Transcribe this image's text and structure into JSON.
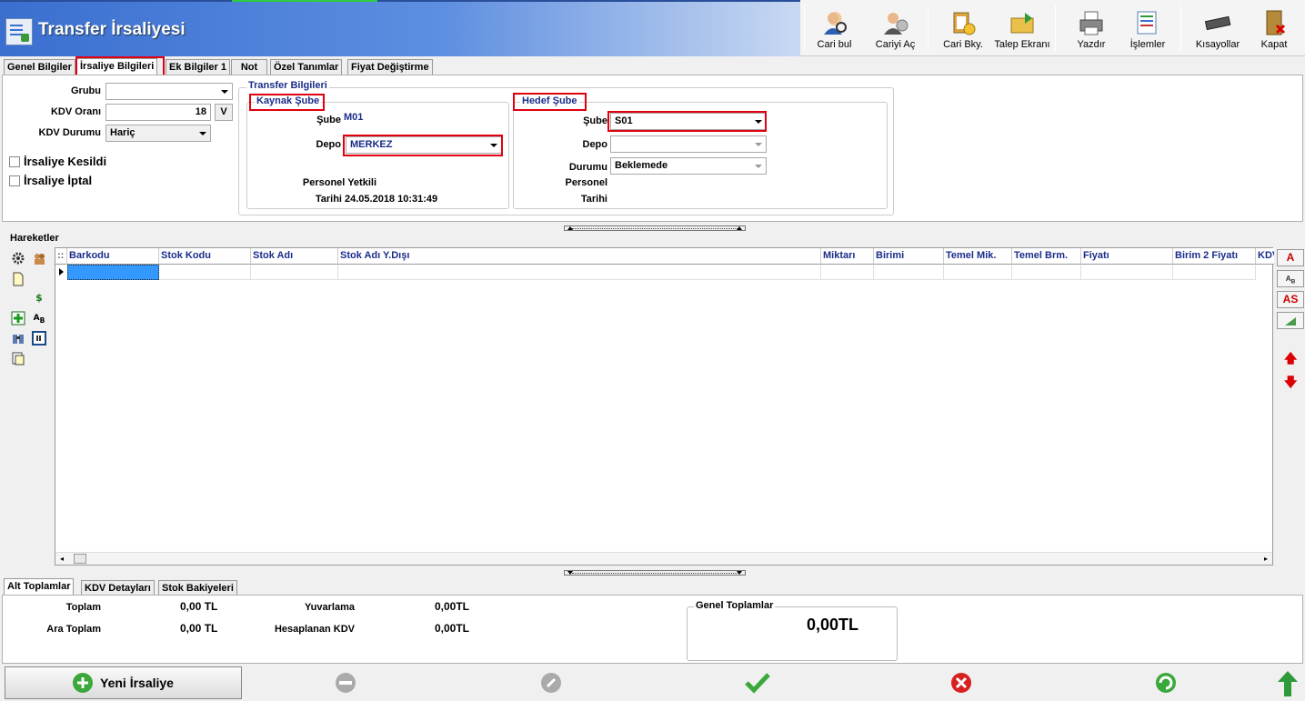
{
  "window": {
    "title": "Transfer İrsaliyesi"
  },
  "toolbar": {
    "cari_bul": "Cari bul",
    "cariyi_ac": "Cariyi Aç",
    "cari_bky": "Cari Bky.",
    "talep_ekrani": "Talep Ekranı",
    "yazdir": "Yazdır",
    "islemler": "İşlemler",
    "kisayollar": "Kısayollar",
    "kapat": "Kapat"
  },
  "tabs": [
    "Genel Bilgiler",
    "İrsaliye Bilgileri",
    "Ek Bilgiler 1",
    "Not",
    "Özel Tanımlar",
    "Fiyat Değiştirme"
  ],
  "form": {
    "grubu_label": "Grubu",
    "grubu_value": "",
    "kdv_orani_label": "KDV Oranı",
    "kdv_orani_value": "18",
    "kdv_v_button": "V",
    "kdv_durumu_label": "KDV Durumu",
    "kdv_durumu_value": "Hariç",
    "irsaliye_kesildi": "İrsaliye Kesildi",
    "irsaliye_iptal": "İrsaliye İptal"
  },
  "transfer": {
    "title": "Transfer Bilgileri",
    "kaynak": {
      "title": "Kaynak Şube",
      "sube_label": "Şube",
      "sube_value": "M01",
      "depo_label": "Depo",
      "depo_value": "MERKEZ",
      "personel_label": "Personel Yetkili",
      "tarih_label": "Tarihi",
      "tarih_value": "24.05.2018 10:31:49"
    },
    "hedef": {
      "title": "Hedef Şube",
      "sube_label": "Şube",
      "sube_value": "S01",
      "depo_label": "Depo",
      "depo_value": "",
      "durum_label": "Durumu",
      "durum_value": "Beklemede",
      "personel_label": "Personel",
      "tarih_label": "Tarihi"
    }
  },
  "hareketler": {
    "title": "Hareketler",
    "columns": [
      "Barkodu",
      "Stok Kodu",
      "Stok Adı",
      "Stok Adı Y.Dışı",
      "Miktarı",
      "Birimi",
      "Temel Mik.",
      "Temel Brm.",
      "Fiyatı",
      "Birim 2 Fiyatı",
      "KDV"
    ],
    "right_buttons": [
      "A",
      "AS"
    ]
  },
  "bottom_tabs": [
    "Alt Toplamlar",
    "KDV Detayları",
    "Stok Bakiyeleri"
  ],
  "totals": {
    "toplam_label": "Toplam",
    "toplam_value": "0,00 TL",
    "ara_toplam_label": "Ara Toplam",
    "ara_toplam_value": "0,00 TL",
    "yuvarlama_label": "Yuvarlama",
    "yuvarlama_value": "0,00TL",
    "hesaplanan_kdv_label": "Hesaplanan KDV",
    "hesaplanan_kdv_value": "0,00TL",
    "genel_label": "Genel Toplamlar",
    "genel_value": "0,00TL"
  },
  "footer": {
    "yeni_irsaliye": "Yeni İrsaliye"
  },
  "colors": {
    "accent_red": "#e00010",
    "title_blue": "#3a6fd0",
    "label_blue": "#1a2d8a"
  }
}
